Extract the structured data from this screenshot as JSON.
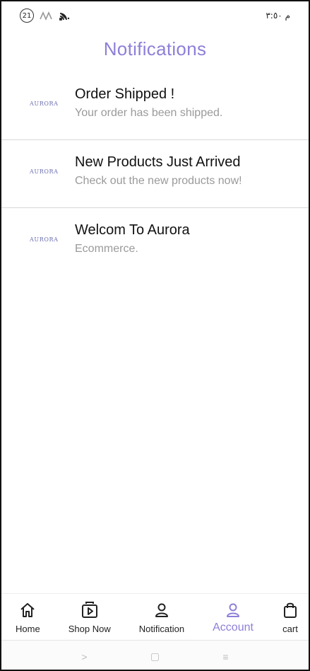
{
  "status_bar": {
    "badge": "21",
    "time": "م ٣:٥٠",
    "icons": [
      "notification-badge-icon",
      "activity-icon",
      "wifi-signal-icon"
    ]
  },
  "header": {
    "title": "Notifications"
  },
  "notifications": [
    {
      "logo": "AURORA",
      "title": "Order Shipped !",
      "subtitle": "Your order has been shipped."
    },
    {
      "logo": "AURORA",
      "title": "New Products Just Arrived",
      "subtitle": "Check out the new products now!"
    },
    {
      "logo": "AURORA",
      "title": "Welcom To Aurora",
      "subtitle": "Ecommerce."
    }
  ],
  "bottom_nav": {
    "items": [
      {
        "label": "Home",
        "icon": "home-icon"
      },
      {
        "label": "Shop Now",
        "icon": "play-store-icon"
      },
      {
        "label": "Notification",
        "icon": "user-icon"
      },
      {
        "label": "Account",
        "icon": "user-icon",
        "active": true
      },
      {
        "label": "cart",
        "icon": "bag-icon"
      }
    ],
    "active_color": "#8f7fd8"
  },
  "system_nav": {
    "back": ">",
    "home": "▢",
    "recents": "≡"
  }
}
